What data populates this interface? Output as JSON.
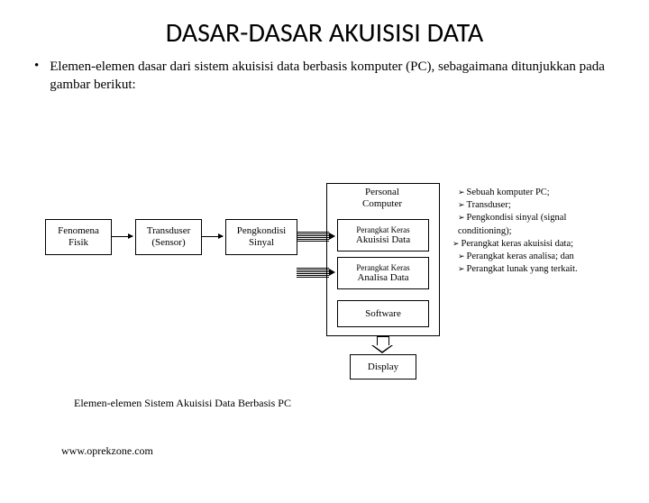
{
  "title": "DASAR-DASAR AKUISISI DATA",
  "bullet": "Elemen-elemen dasar dari sistem akuisisi data berbasis komputer (PC), sebagaimana ditunjukkan pada gambar berikut:",
  "boxes": {
    "fenomena_l1": "Fenomena",
    "fenomena_l2": "Fisik",
    "transduser_l1": "Transduser",
    "transduser_l2": "(Sensor)",
    "pengkondisi_l1": "Pengkondisi",
    "pengkondisi_l2": "Sinyal",
    "pc_l1": "Personal",
    "pc_l2": "Computer",
    "akuisisi_sm": "Perangkat Keras",
    "akuisisi_lg": "Akuisisi Data",
    "analisa_sm": "Perangkat Keras",
    "analisa_lg": "Analisa Data",
    "software": "Software",
    "display": "Display"
  },
  "side_list": [
    "Sebuah komputer PC;",
    "Transduser;",
    "Pengkondisi sinyal (signal conditioning);",
    "Perangkat keras akuisisi data;",
    "Perangkat keras analisa; dan",
    "Perangkat lunak yang terkait."
  ],
  "caption": "Elemen-elemen Sistem Akuisisi Data Berbasis PC",
  "url": "www.oprekzone.com"
}
